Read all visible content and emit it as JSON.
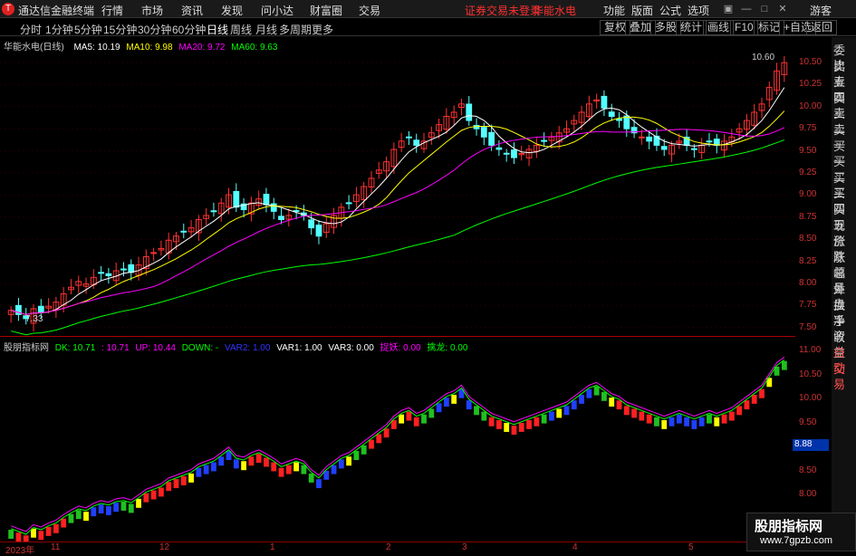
{
  "app": {
    "logo": "T",
    "title": "通达信金融终端"
  },
  "menu": [
    "行情",
    "市场",
    "资讯",
    "发现",
    "问小达",
    "财富圈",
    "交易"
  ],
  "notice": {
    "login": "证券交易未登录",
    "stock": "华能水电"
  },
  "top_right_menu": [
    "功能",
    "版面",
    "公式",
    "选项"
  ],
  "guest": "游客",
  "periods": [
    "分时",
    "1分钟",
    "5分钟",
    "15分钟",
    "30分钟",
    "60分钟",
    "日线",
    "周线",
    "月线",
    "多周期",
    "更多"
  ],
  "active_period": "日线",
  "toolbar": [
    "复权",
    "叠加",
    "多股",
    "统计",
    "画线",
    "F10",
    "标记",
    "+自选",
    "返回"
  ],
  "main_legend": {
    "title": "华能水电(日线)",
    "ma5": "MA5: 10.19",
    "ma10": "MA10: 9.98",
    "ma20": "MA20: 9.72",
    "ma60": "MA60: 9.63"
  },
  "main_annotations": {
    "high": "10.60",
    "low": "7.33"
  },
  "main_axis": [
    "10.50",
    "10.25",
    "10.00",
    "9.75",
    "9.50",
    "9.25",
    "9.00",
    "8.75",
    "8.50",
    "8.25",
    "8.00",
    "7.75",
    "7.50"
  ],
  "sub_legend": {
    "title": "股朋指标网",
    "dk": "DK: 10.71",
    "v2": ": 10.71",
    "up": "UP: 10.44",
    "down": "DOWN: -",
    "var2": "VAR2: 1.00",
    "var1": "VAR1: 1.00",
    "var3": "VAR3: 0.00",
    "zy": "捉妖: 0.00",
    "ql": "擒龙: 0.00"
  },
  "sub_axis": [
    "11.00",
    "10.50",
    "10.00",
    "9.50",
    "9.00",
    "8.50",
    "8.00"
  ],
  "sub_axis_price": "8.88",
  "date_axis": [
    "2023年",
    "11",
    "12",
    "1",
    "2",
    "3",
    "4",
    "5"
  ],
  "right_panel": [
    "委比",
    "卖五",
    "卖四",
    "卖三",
    "卖二",
    "卖一",
    "买一",
    "买二",
    "买三",
    "买四",
    "买五",
    "现价",
    "涨跌",
    "涨幅",
    "总量",
    "外盘",
    "换手",
    "净资",
    "收益",
    "自动",
    "交易"
  ],
  "watermark": {
    "line1": "股朋指标网",
    "line2": "www.7gpzb.com"
  },
  "colors": {
    "up": "#ff3232",
    "down": "#54ffff",
    "ma5": "#ffffff",
    "ma10": "#ffff00",
    "ma20": "#ff00ff",
    "ma60": "#00ff00"
  },
  "chart_data": {
    "type": "candlestick",
    "closes": [
      7.5,
      7.45,
      7.4,
      7.52,
      7.48,
      7.55,
      7.6,
      7.7,
      7.78,
      7.85,
      7.82,
      7.9,
      7.95,
      7.92,
      7.98,
      8.0,
      7.96,
      8.05,
      8.15,
      8.2,
      8.25,
      8.35,
      8.4,
      8.45,
      8.5,
      8.6,
      8.65,
      8.7,
      8.8,
      8.9,
      8.75,
      8.72,
      8.8,
      8.85,
      8.78,
      8.7,
      8.6,
      8.65,
      8.7,
      8.65,
      8.5,
      8.4,
      8.55,
      8.65,
      8.75,
      8.8,
      8.9,
      9.0,
      9.1,
      9.2,
      9.3,
      9.45,
      9.55,
      9.6,
      9.5,
      9.55,
      9.65,
      9.75,
      9.85,
      9.9,
      10.0,
      9.8,
      9.7,
      9.6,
      9.5,
      9.45,
      9.4,
      9.35,
      9.4,
      9.45,
      9.5,
      9.55,
      9.6,
      9.65,
      9.7,
      9.8,
      9.9,
      10.0,
      10.05,
      9.95,
      9.85,
      9.8,
      9.7,
      9.65,
      9.6,
      9.55,
      9.5,
      9.45,
      9.5,
      9.55,
      9.5,
      9.45,
      9.5,
      9.55,
      9.5,
      9.55,
      9.6,
      9.7,
      9.8,
      9.9,
      10.0,
      10.2,
      10.4,
      10.5
    ],
    "ylim": [
      7.3,
      10.7
    ],
    "sub_ylim": [
      7.8,
      11.1
    ]
  }
}
